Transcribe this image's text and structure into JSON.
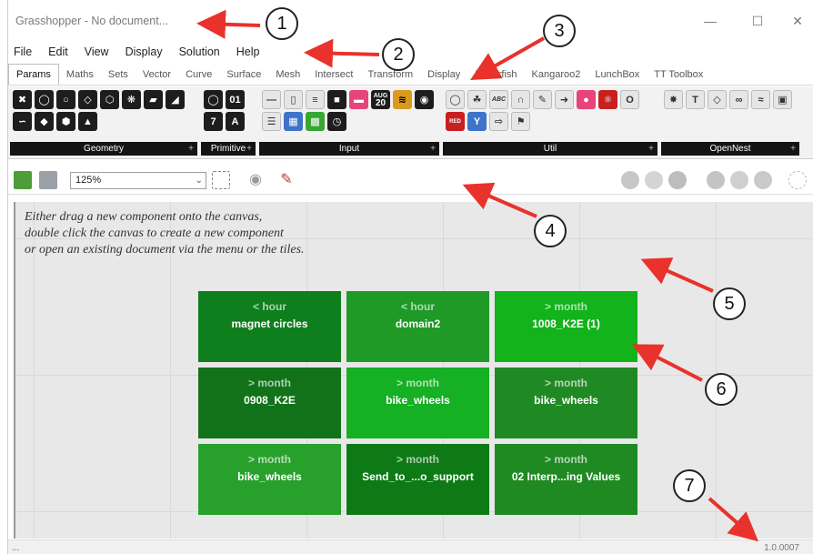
{
  "window": {
    "title": "Grasshopper - No document..."
  },
  "menu": [
    "File",
    "Edit",
    "View",
    "Display",
    "Solution",
    "Help"
  ],
  "tabs": [
    "Params",
    "Maths",
    "Sets",
    "Vector",
    "Curve",
    "Surface",
    "Mesh",
    "Intersect",
    "Transform",
    "Display",
    "Pufferfish",
    "Kangaroo2",
    "LunchBox",
    "TT Toolbox"
  ],
  "ribbon": {
    "groups": [
      {
        "label": "Geometry"
      },
      {
        "label": "Primitive"
      },
      {
        "label": "Input"
      },
      {
        "label": "Util"
      },
      {
        "label": "OpenNest"
      }
    ],
    "input_calendar_month": "AUG",
    "input_calendar_day": "20",
    "util_text_icon": "ABC",
    "util_button_red": "RED"
  },
  "toolbar": {
    "zoom": "125%"
  },
  "canvas": {
    "hint_lines": [
      "Either drag a new component onto the canvas,",
      "double click the canvas to create a new component",
      "or open an existing document via the menu or the tiles."
    ],
    "tiles": [
      {
        "age": "< hour",
        "name": "magnet circles",
        "color": "#0f7f1d"
      },
      {
        "age": "< hour",
        "name": "domain2",
        "color": "#1f9a26"
      },
      {
        "age": "> month",
        "name": "1008_K2E (1)",
        "color": "#12b31b"
      },
      {
        "age": "> month",
        "name": "0908_K2E",
        "color": "#127219"
      },
      {
        "age": "> month",
        "name": "bike_wheels",
        "color": "#15b023"
      },
      {
        "age": "> month",
        "name": "bike_wheels",
        "color": "#1f8a23"
      },
      {
        "age": "> month",
        "name": "bike_wheels",
        "color": "#27a12c"
      },
      {
        "age": "> month",
        "name": "Send_to_...o_support",
        "color": "#0d7a16"
      },
      {
        "age": "> month",
        "name": "02 Interp...ing Values",
        "color": "#1f8a22"
      }
    ]
  },
  "status": {
    "left": "...",
    "version": "1.0.0007"
  },
  "annotations": [
    "1",
    "2",
    "3",
    "4",
    "5",
    "6",
    "7"
  ]
}
